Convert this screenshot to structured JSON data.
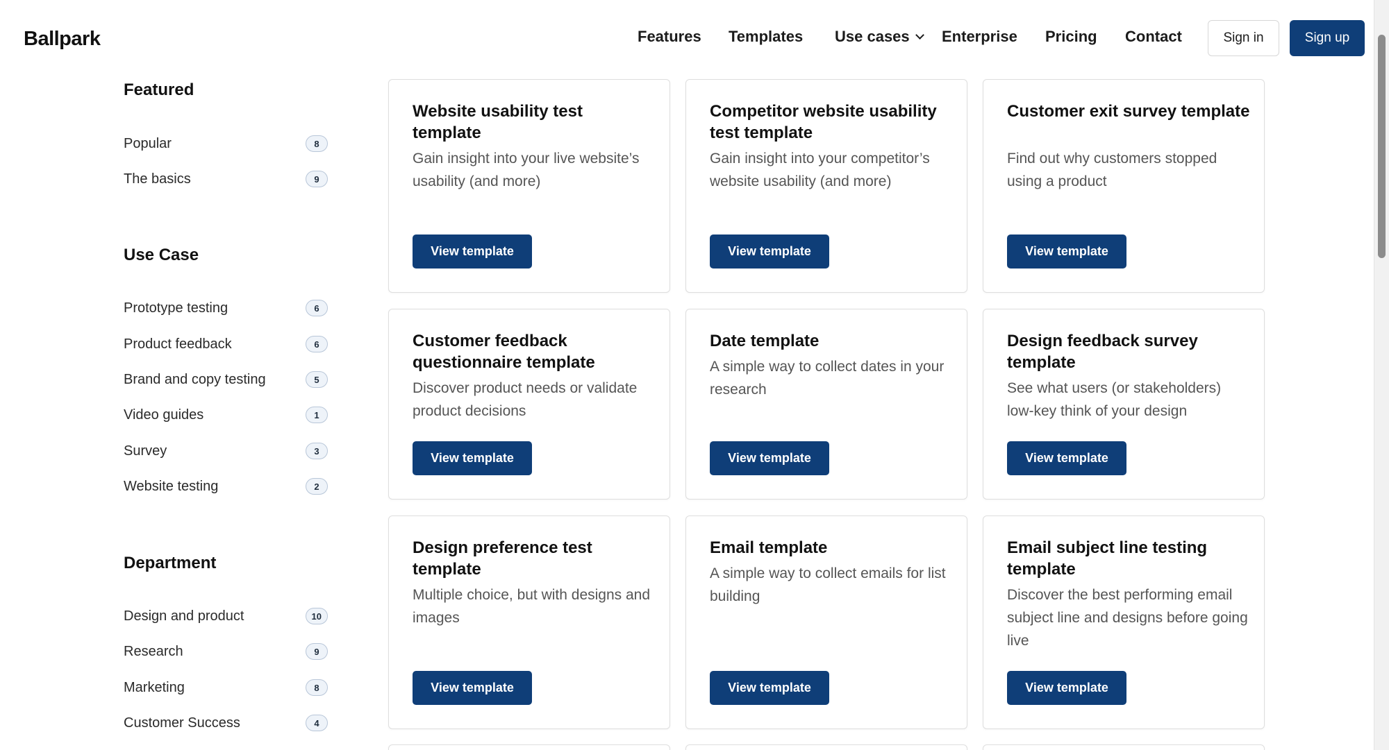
{
  "brand": {
    "logo": "Ballpark",
    "accent": "#0f3e78"
  },
  "nav": {
    "links": [
      "Features",
      "Templates",
      "Use cases",
      "Enterprise",
      "Pricing",
      "Contact"
    ],
    "sign_in": "Sign in",
    "sign_up": "Sign up"
  },
  "sidebar": {
    "featured": {
      "heading": "Featured",
      "items": [
        {
          "label": "Popular",
          "count": "8"
        },
        {
          "label": "The basics",
          "count": "9"
        }
      ]
    },
    "use_case": {
      "heading": "Use Case",
      "items": [
        {
          "label": "Prototype testing",
          "count": "6"
        },
        {
          "label": "Product feedback",
          "count": "6"
        },
        {
          "label": "Brand and copy testing",
          "count": "5"
        },
        {
          "label": "Video guides",
          "count": "1"
        },
        {
          "label": "Survey",
          "count": "3"
        },
        {
          "label": "Website testing",
          "count": "2"
        }
      ]
    },
    "department": {
      "heading": "Department",
      "items": [
        {
          "label": "Design and product",
          "count": "10"
        },
        {
          "label": "Research",
          "count": "9"
        },
        {
          "label": "Marketing",
          "count": "8"
        },
        {
          "label": "Customer Success",
          "count": "4"
        }
      ]
    }
  },
  "cards": [
    {
      "title": "Website usability test template",
      "desc": "Gain insight into your live website’s usability (and more)",
      "button": "View template"
    },
    {
      "title": "Competitor website usability test template",
      "desc": "Gain insight into your competitor’s website usability (and more)",
      "button": "View template"
    },
    {
      "title": "Customer exit survey template",
      "desc": "Find out why customers stopped using a product",
      "button": "View template"
    },
    {
      "title": "Customer feedback questionnaire template",
      "desc": "Discover product needs or validate product decisions",
      "button": "View template"
    },
    {
      "title": "Date template",
      "desc": "A simple way to collect dates in your research",
      "button": "View template"
    },
    {
      "title": "Design feedback survey template",
      "desc": "See what users (or stakeholders) low-key think of your design",
      "button": "View template"
    },
    {
      "title": "Design preference test template",
      "desc": "Multiple choice, but with designs and images",
      "button": "View template"
    },
    {
      "title": "Email template",
      "desc": "A simple way to collect emails for list building",
      "button": "View template"
    },
    {
      "title": "Email subject line testing template",
      "desc": "Discover the best performing email subject line and designs before going live",
      "button": "View template"
    }
  ]
}
